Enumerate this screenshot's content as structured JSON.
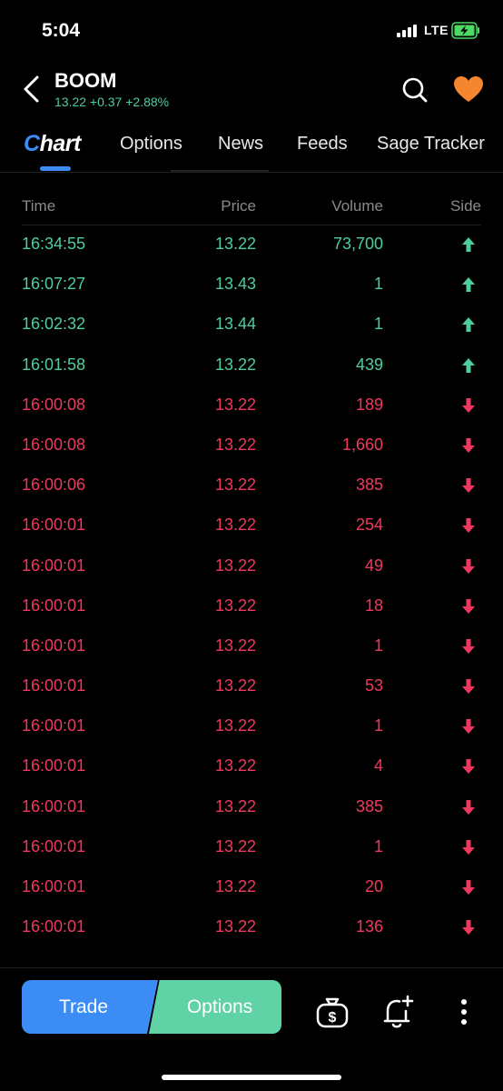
{
  "status_bar": {
    "time": "5:04",
    "network": "LTE"
  },
  "header": {
    "ticker": "BOOM",
    "quote": "13.22 +0.37 +2.88%",
    "icons": [
      "chevron-left-icon",
      "search-icon",
      "heart-icon"
    ]
  },
  "tabs": [
    {
      "label": "hart",
      "active": true
    },
    {
      "label": "Options"
    },
    {
      "label": "News"
    },
    {
      "label": "Feeds"
    },
    {
      "label": "Sage Tracker"
    }
  ],
  "tab_active_prefix": "C",
  "table": {
    "headers": {
      "time": "Time",
      "price": "Price",
      "volume": "Volume",
      "side": "Side"
    },
    "rows": [
      {
        "time": "16:34:55",
        "price": "13.22",
        "volume": "73,700",
        "side": "up"
      },
      {
        "time": "16:07:27",
        "price": "13.43",
        "volume": "1",
        "side": "up"
      },
      {
        "time": "16:02:32",
        "price": "13.44",
        "volume": "1",
        "side": "up"
      },
      {
        "time": "16:01:58",
        "price": "13.22",
        "volume": "439",
        "side": "up"
      },
      {
        "time": "16:00:08",
        "price": "13.22",
        "volume": "189",
        "side": "down"
      },
      {
        "time": "16:00:08",
        "price": "13.22",
        "volume": "1,660",
        "side": "down"
      },
      {
        "time": "16:00:06",
        "price": "13.22",
        "volume": "385",
        "side": "down"
      },
      {
        "time": "16:00:01",
        "price": "13.22",
        "volume": "254",
        "side": "down"
      },
      {
        "time": "16:00:01",
        "price": "13.22",
        "volume": "49",
        "side": "down"
      },
      {
        "time": "16:00:01",
        "price": "13.22",
        "volume": "18",
        "side": "down"
      },
      {
        "time": "16:00:01",
        "price": "13.22",
        "volume": "1",
        "side": "down"
      },
      {
        "time": "16:00:01",
        "price": "13.22",
        "volume": "53",
        "side": "down"
      },
      {
        "time": "16:00:01",
        "price": "13.22",
        "volume": "1",
        "side": "down"
      },
      {
        "time": "16:00:01",
        "price": "13.22",
        "volume": "4",
        "side": "down"
      },
      {
        "time": "16:00:01",
        "price": "13.22",
        "volume": "385",
        "side": "down"
      },
      {
        "time": "16:00:01",
        "price": "13.22",
        "volume": "1",
        "side": "down"
      },
      {
        "time": "16:00:01",
        "price": "13.22",
        "volume": "20",
        "side": "down"
      },
      {
        "time": "16:00:01",
        "price": "13.22",
        "volume": "136",
        "side": "down"
      }
    ]
  },
  "bottom_bar": {
    "trade_label": "Trade",
    "options_label": "Options",
    "icons": [
      "money-bag-icon",
      "bell-plus-icon",
      "more-vertical-icon"
    ]
  },
  "colors": {
    "up": "#4ccf9c",
    "down": "#f0385e",
    "accent": "#3b8cf5",
    "options_green": "#5fd3a5",
    "background": "#000000"
  }
}
